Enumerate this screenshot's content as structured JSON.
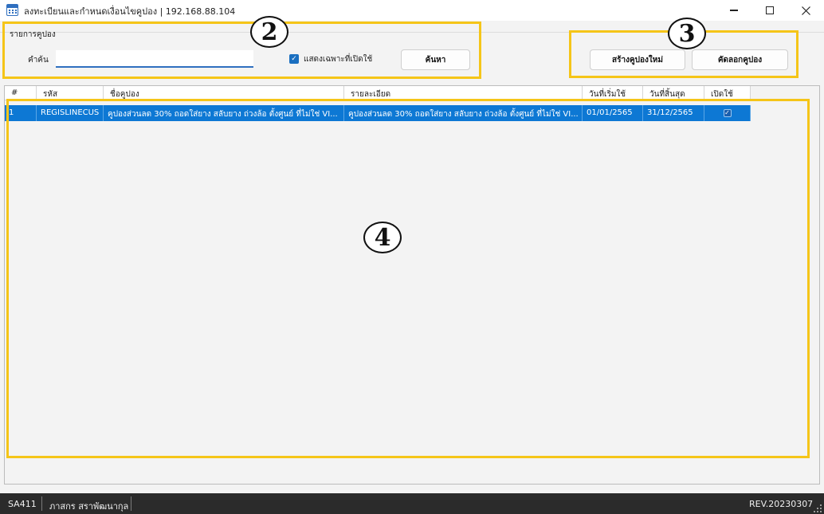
{
  "window": {
    "title": "ลงทะเบียนและกำหนดเงื่อนไขคูปอง | 192.168.88.104",
    "minimize_icon": "minimize-icon",
    "maximize_icon": "maximize-icon",
    "close_icon": "close-icon"
  },
  "search_panel": {
    "group_label": "รายการคูปอง",
    "search_label": "คำค้น",
    "search_value": "",
    "checkbox_label": "แสดงเฉพาะที่เปิดใช้",
    "checkbox_checked": true,
    "search_button": "ค้นหา"
  },
  "actions": {
    "create_button": "สร้างคูปองใหม่",
    "cut_button": "คัดลอกคูปอง"
  },
  "annotations": {
    "badge_2": "2",
    "badge_3": "3",
    "badge_4": "4",
    "highlight_color": "#f5c518"
  },
  "table": {
    "columns": [
      "#",
      "รหัส",
      "ชื่อคูปอง",
      "รายละเอียด",
      "วันที่เริ่มใช้",
      "วันที่สิ้นสุด",
      "เปิดใช้"
    ],
    "rows": [
      {
        "no": "1",
        "code": "REGISLINECUS",
        "name": "คูปองส่วนลด 30% ถอดใส่ยาง สลับยาง ถ่วงล้อ ตั้งศูนย์ ที่ไม่ใช่ VI...",
        "detail": "คูปองส่วนลด 30% ถอดใส่ยาง สลับยาง ถ่วงล้อ ตั้งศูนย์ ที่ไม่ใช่ VI...",
        "start": "01/01/2565",
        "end": "31/12/2565",
        "enabled": true
      }
    ],
    "selected_row_color": "#0d78d4"
  },
  "statusbar": {
    "branch": "SA411",
    "user": "ภาสกร สราพัฒนากุล",
    "revision": "REV.20230307"
  }
}
